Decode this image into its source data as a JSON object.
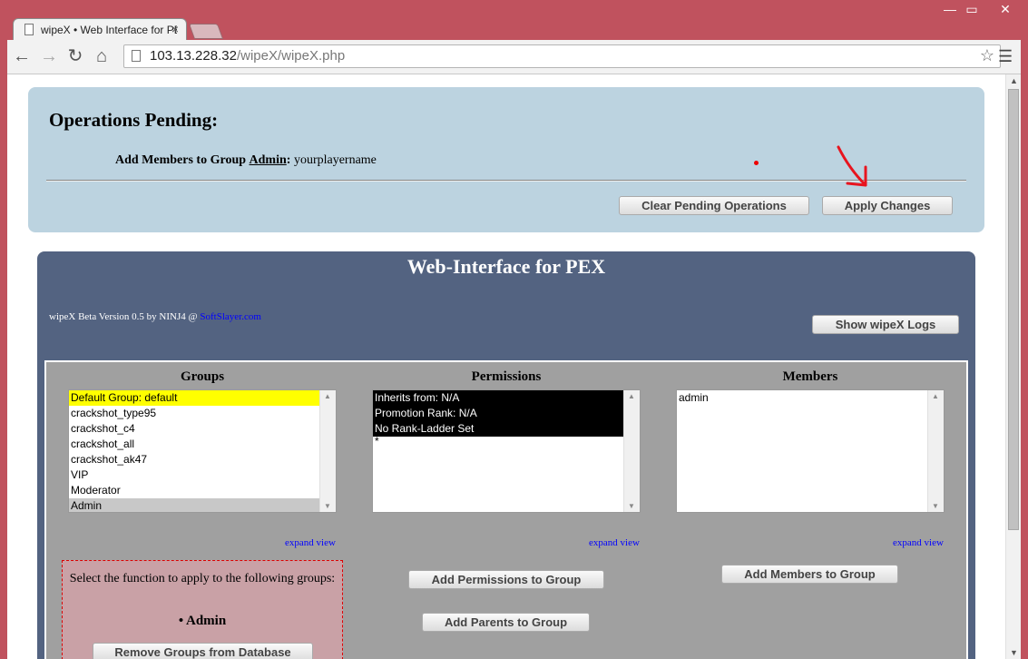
{
  "browser": {
    "tab_title": "wipeX • Web Interface for PEX",
    "tab_close": "×",
    "url_host": "103.13.228.32",
    "url_path": "/wipeX/wipeX.php",
    "win_min": "—",
    "win_max": "▭",
    "win_close": "✕"
  },
  "pending": {
    "title": "Operations Pending:",
    "op_prefix": "Add Members to Group",
    "op_group": "Admin",
    "op_suffix": "yourplayername",
    "clear_label": "Clear Pending Operations",
    "apply_label": "Apply Changes"
  },
  "pex": {
    "title": "Web-Interface for PEX",
    "version_text": "wipeX Beta Version 0.5 by NINJ4 @",
    "version_link": "SoftSlayer.com",
    "logs_label": "Show wipeX Logs"
  },
  "groups": {
    "title": "Groups",
    "items": [
      "Default Group: default",
      "crackshot_type95",
      "crackshot_c4",
      "crackshot_all",
      "crackshot_ak47",
      "VIP",
      "Moderator",
      "Admin"
    ],
    "expand": "expand view"
  },
  "permissions": {
    "title": "Permissions",
    "items": [
      "Inherits from: N/A",
      "Promotion Rank: N/A",
      "No Rank-Ladder Set",
      "*"
    ],
    "expand": "expand view",
    "add_perm_label": "Add Permissions to Group",
    "add_parent_label": "Add Parents to Group"
  },
  "members": {
    "title": "Members",
    "items": [
      "admin"
    ],
    "expand": "expand view",
    "add_members_label": "Add Members to Group"
  },
  "function_box": {
    "text": "Select the function to apply to the following groups:",
    "group": "• Admin",
    "remove_label": "Remove Groups from Database"
  },
  "colors": {
    "chrome_frame": "#c0525e",
    "pending_bg": "#bcd3e0",
    "pex_bg": "#536381",
    "default_group_highlight": "#ffff00",
    "selected_group": "#c8c8c8"
  }
}
